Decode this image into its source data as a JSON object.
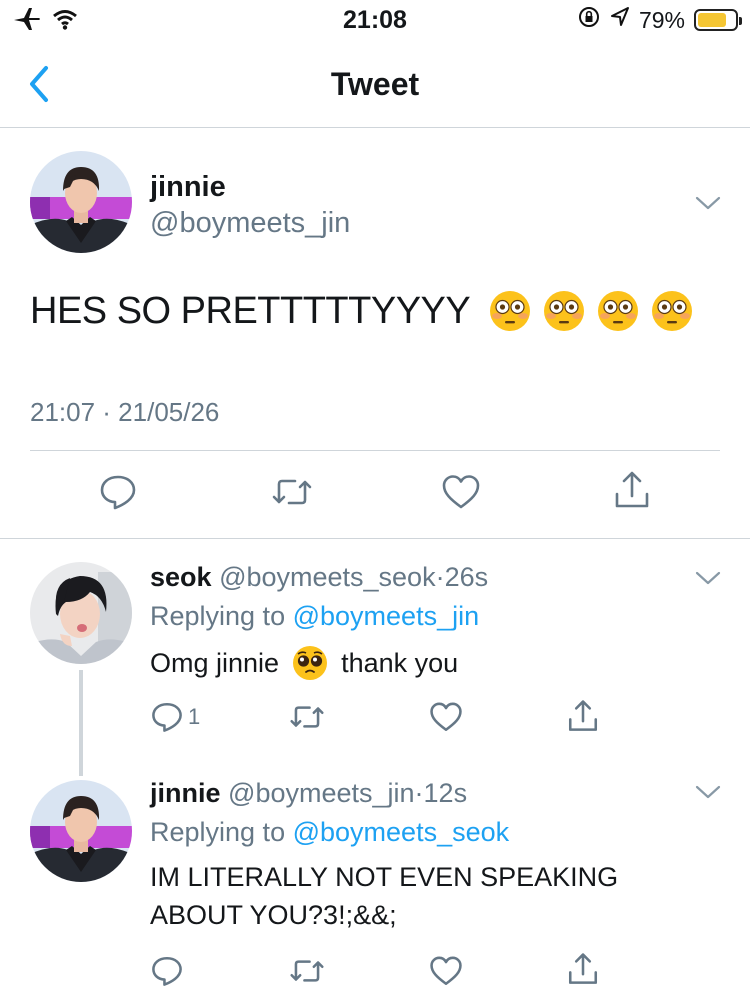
{
  "status_bar": {
    "time": "21:08",
    "battery_percent": "79%",
    "battery_level": 0.79,
    "icons": [
      "airplane-icon",
      "wifi-icon",
      "orientation-lock-icon",
      "location-icon",
      "battery-icon"
    ]
  },
  "nav": {
    "title": "Tweet",
    "back_icon": "chevron-left-icon"
  },
  "tweet": {
    "name": "jinnie",
    "handle": "@boymeets_jin",
    "text": "HES SO PRETTTTTYYYY",
    "emoji": [
      "😳",
      "😳",
      "😳",
      "😳"
    ],
    "timestamp": "21:07 · 21/05/26",
    "actions": [
      "reply-icon",
      "retweet-icon",
      "like-icon",
      "share-icon"
    ]
  },
  "replies": [
    {
      "name": "seok",
      "handle": "@boymeets_seok",
      "separator": "·",
      "time": "26s",
      "replying_prefix": "Replying to",
      "replying_to": "@boymeets_jin",
      "text_before": "Omg jinnie",
      "emoji": "🥺",
      "text_after": "thank you",
      "reply_count": "1"
    },
    {
      "name": "jinnie",
      "handle": "@boymeets_jin",
      "separator": "·",
      "time": "12s",
      "replying_prefix": "Replying to",
      "replying_to": "@boymeets_seok",
      "text_line1": "IM LITERALLY NOT EVEN SPEAKING",
      "text_line2": "ABOUT YOU?3!;&&;"
    }
  ],
  "colors": {
    "link": "#1da1f2",
    "secondary_text": "#657786",
    "divider": "#cfd5da",
    "back_chevron": "#1da1f2",
    "battery_fill": "#f5c633"
  }
}
